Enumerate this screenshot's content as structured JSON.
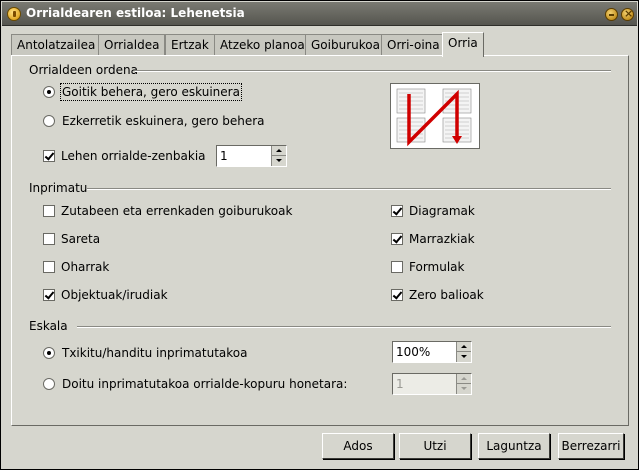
{
  "window": {
    "title": "Orrialdearen estiloa: Lehenetsia"
  },
  "tabs": [
    "Antolatzailea",
    "Orrialdea",
    "Ertzak",
    "Atzeko planoa",
    "Goiburukoa",
    "Orri-oina",
    "Orria"
  ],
  "active_tab": "Orria",
  "page_order": {
    "title": "Orrialdeen ordena",
    "options": [
      {
        "label": "Goitik behera, gero eskuinera",
        "selected": true
      },
      {
        "label": "Ezkerretik eskuinera, gero behera",
        "selected": false
      }
    ],
    "first_page_label": "Lehen orrialde-zenbakia",
    "first_page_checked": true,
    "first_page_value": "1"
  },
  "print": {
    "title": "Inprimatu",
    "left": [
      {
        "label": "Zutabeen eta errenkaden goiburukoak",
        "checked": false
      },
      {
        "label": "Sareta",
        "checked": false
      },
      {
        "label": "Oharrak",
        "checked": false
      },
      {
        "label": "Objektuak/irudiak",
        "checked": true
      }
    ],
    "right": [
      {
        "label": "Diagramak",
        "checked": true
      },
      {
        "label": "Marrazkiak",
        "checked": true
      },
      {
        "label": "Formulak",
        "checked": false
      },
      {
        "label": "Zero balioak",
        "checked": true
      }
    ]
  },
  "scale": {
    "title": "Eskala",
    "reduce_label": "Txikitu/handitu inprimatutakoa",
    "reduce_selected": true,
    "reduce_value": "100%",
    "fit_label": "Doitu inprimatutakoa orrialde-kopuru honetara:",
    "fit_selected": false,
    "fit_value": "1"
  },
  "buttons": {
    "ok": "Ados",
    "cancel": "Utzi",
    "help": "Laguntza",
    "reset": "Berrezarri"
  },
  "icons": {
    "app": "app-bulb-icon",
    "minimize": "minimize-icon",
    "close": "close-icon",
    "preview": "page-order-preview-icon"
  }
}
